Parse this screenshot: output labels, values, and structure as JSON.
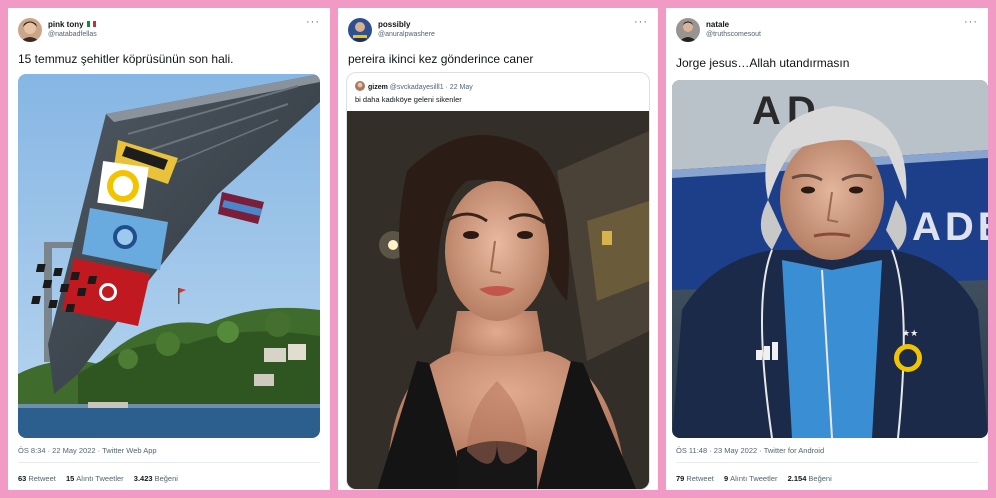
{
  "tweets": [
    {
      "name": "pink tony",
      "handle": "@natabadfellas",
      "text": "15 temmuz şehitler köprüsünün son hali.",
      "timestamp": "ÖS 8:34 · 22 May 2022 · Twitter Web App",
      "retweets": "63",
      "retweets_label": "Retweet",
      "quotes": "15",
      "quotes_label": "Alıntı Tweetler",
      "likes": "3.423",
      "likes_label": "Beğeni"
    },
    {
      "name": "possibly",
      "handle": "@anuralpwashere",
      "text": "pereira ikinci kez gönderince caner",
      "quoted": {
        "name": "gizem",
        "handle": "@svckadayesilll1 · 22 May",
        "text": "bi daha kadıköye geleni sikenler"
      }
    },
    {
      "name": "natale",
      "handle": "@truthscomesout",
      "text": "Jorge jesus…Allah utandırmasın",
      "timestamp": "ÖS 11:48 · 23 May 2022 · Twitter for Android",
      "retweets": "79",
      "retweets_label": "Retweet",
      "quotes": "9",
      "quotes_label": "Alıntı Tweetler",
      "likes": "2.154",
      "likes_label": "Beğeni"
    }
  ],
  "photo_text": {
    "stadium_banner": "AD",
    "stadium_sign": "ADE"
  },
  "icons": {
    "more": "more-horizontal-icon",
    "italy_flag": "italy-flag-icon"
  },
  "colors": {
    "background": "#f29ac6",
    "card": "#ffffff",
    "text_primary": "#0f1419",
    "text_secondary": "#536471"
  }
}
